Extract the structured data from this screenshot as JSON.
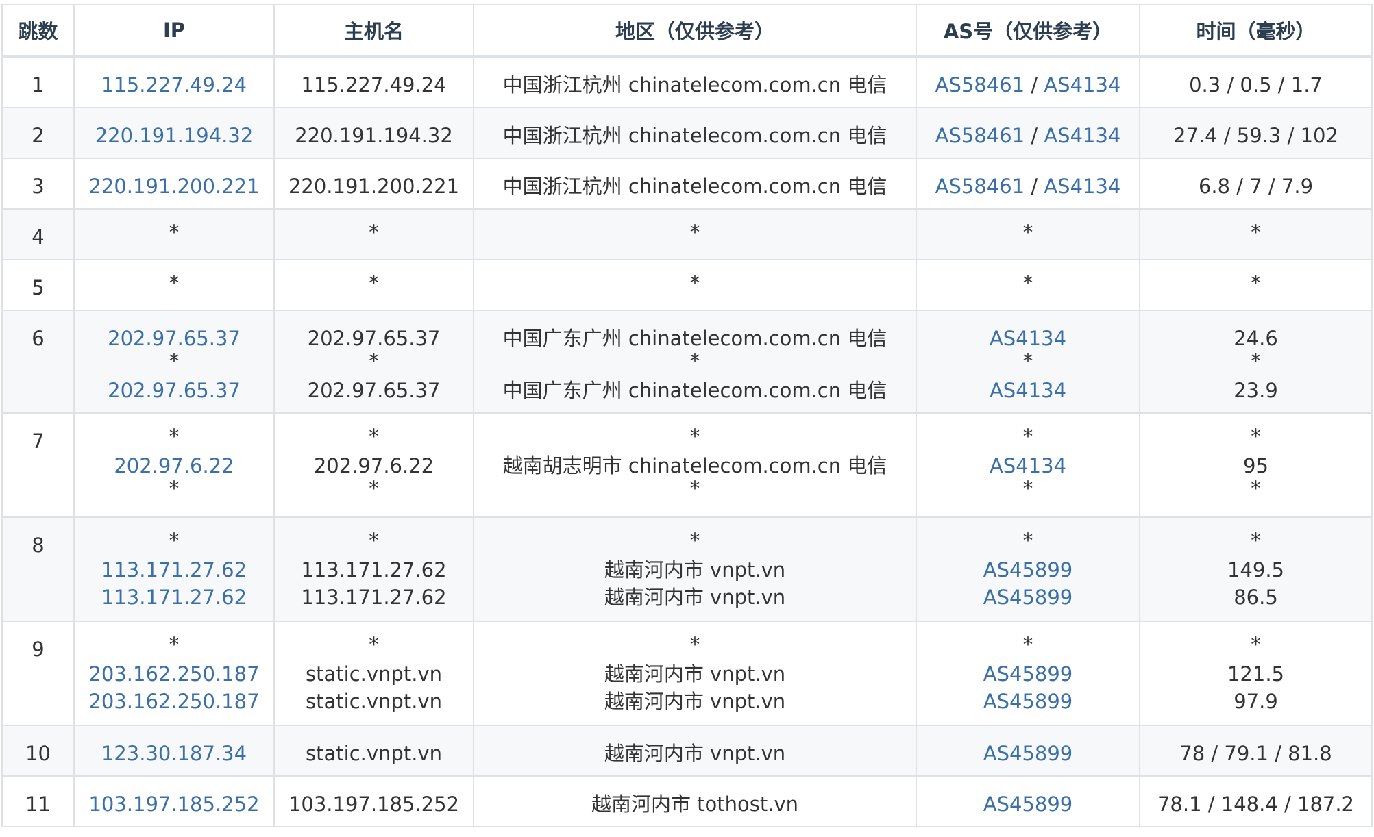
{
  "headers": [
    "跳数",
    "IP",
    "主机名",
    "地区（仅供参考）",
    "AS号（仅供参考）",
    "时间（毫秒）"
  ],
  "rows": [
    {
      "hop": "1",
      "lines": [
        {
          "ip": "115.227.49.24",
          "host": "115.227.49.24",
          "region": "中国浙江杭州 chinatelecom.com.cn 电信",
          "as": [
            "AS58461",
            "AS4134"
          ],
          "time": "0.3 / 0.5 / 1.7"
        }
      ]
    },
    {
      "hop": "2",
      "lines": [
        {
          "ip": "220.191.194.32",
          "host": "220.191.194.32",
          "region": "中国浙江杭州 chinatelecom.com.cn 电信",
          "as": [
            "AS58461",
            "AS4134"
          ],
          "time": "27.4 / 59.3 / 102"
        }
      ]
    },
    {
      "hop": "3",
      "lines": [
        {
          "ip": "220.191.200.221",
          "host": "220.191.200.221",
          "region": "中国浙江杭州 chinatelecom.com.cn 电信",
          "as": [
            "AS58461",
            "AS4134"
          ],
          "time": "6.8 / 7 / 7.9"
        }
      ]
    },
    {
      "hop": "4",
      "lines": [
        {
          "ip": "*",
          "host": "*",
          "region": "*",
          "as": [
            "*"
          ],
          "time": "*"
        }
      ]
    },
    {
      "hop": "5",
      "lines": [
        {
          "ip": "*",
          "host": "*",
          "region": "*",
          "as": [
            "*"
          ],
          "time": "*"
        }
      ]
    },
    {
      "hop": "6",
      "lines": [
        {
          "ip": "202.97.65.37",
          "host": "202.97.65.37",
          "region": "中国广东广州 chinatelecom.com.cn 电信",
          "as": [
            "AS4134"
          ],
          "time": "24.6"
        },
        {
          "ip": "*",
          "host": "*",
          "region": "*",
          "as": [
            "*"
          ],
          "time": "*"
        },
        {
          "ip": "202.97.65.37",
          "host": "202.97.65.37",
          "region": "中国广东广州 chinatelecom.com.cn 电信",
          "as": [
            "AS4134"
          ],
          "time": "23.9"
        }
      ]
    },
    {
      "hop": "7",
      "lines": [
        {
          "ip": "*",
          "host": "*",
          "region": "*",
          "as": [
            "*"
          ],
          "time": "*"
        },
        {
          "ip": "202.97.6.22",
          "host": "202.97.6.22",
          "region": "越南胡志明市 chinatelecom.com.cn 电信",
          "as": [
            "AS4134"
          ],
          "time": "95"
        },
        {
          "ip": "*",
          "host": "*",
          "region": "*",
          "as": [
            "*"
          ],
          "time": "*"
        }
      ]
    },
    {
      "hop": "8",
      "lines": [
        {
          "ip": "*",
          "host": "*",
          "region": "*",
          "as": [
            "*"
          ],
          "time": "*"
        },
        {
          "ip": "113.171.27.62",
          "host": "113.171.27.62",
          "region": "越南河内市 vnpt.vn",
          "as": [
            "AS45899"
          ],
          "time": "149.5"
        },
        {
          "ip": "113.171.27.62",
          "host": "113.171.27.62",
          "region": "越南河内市 vnpt.vn",
          "as": [
            "AS45899"
          ],
          "time": "86.5"
        }
      ]
    },
    {
      "hop": "9",
      "lines": [
        {
          "ip": "*",
          "host": "*",
          "region": "*",
          "as": [
            "*"
          ],
          "time": "*"
        },
        {
          "ip": "203.162.250.187",
          "host": "static.vnpt.vn",
          "region": "越南河内市 vnpt.vn",
          "as": [
            "AS45899"
          ],
          "time": "121.5"
        },
        {
          "ip": "203.162.250.187",
          "host": "static.vnpt.vn",
          "region": "越南河内市 vnpt.vn",
          "as": [
            "AS45899"
          ],
          "time": "97.9"
        }
      ]
    },
    {
      "hop": "10",
      "lines": [
        {
          "ip": "123.30.187.34",
          "host": "static.vnpt.vn",
          "region": "越南河内市 vnpt.vn",
          "as": [
            "AS45899"
          ],
          "time": "78 / 79.1 / 81.8"
        }
      ]
    },
    {
      "hop": "11",
      "lines": [
        {
          "ip": "103.197.185.252",
          "host": "103.197.185.252",
          "region": "越南河内市 tothost.vn",
          "as": [
            "AS45899"
          ],
          "time": "78.1 / 148.4 / 187.2"
        }
      ]
    }
  ],
  "colors": {
    "link": "#3b6fa8",
    "border": "#dfe2e5",
    "stripe": "#f6f8fa",
    "header_text": "#2c3e50"
  }
}
